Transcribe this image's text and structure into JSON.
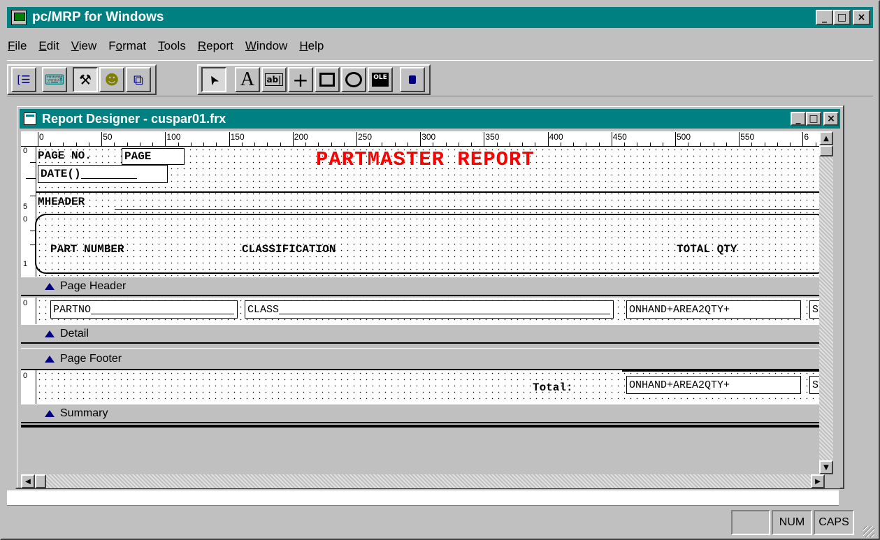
{
  "app": {
    "title": "pc/MRP for Windows",
    "window_buttons": {
      "minimize": "_",
      "maximize": "□",
      "close": "×"
    }
  },
  "menu": [
    {
      "label": "File",
      "accel": "F",
      "rest": "ile"
    },
    {
      "label": "Edit",
      "accel": "E",
      "rest": "dit"
    },
    {
      "label": "View",
      "accel": "V",
      "rest": "iew"
    },
    {
      "label": "Format",
      "accel": "o",
      "pre": "F",
      "rest": "rmat"
    },
    {
      "label": "Tools",
      "accel": "T",
      "rest": "ools"
    },
    {
      "label": "Report",
      "accel": "R",
      "rest": "eport"
    },
    {
      "label": "Window",
      "accel": "W",
      "rest": "indow"
    },
    {
      "label": "Help",
      "accel": "H",
      "rest": "elp"
    }
  ],
  "toolbar": {
    "group1": [
      "field-list-icon",
      "data-environment-icon",
      "tools-icon",
      "color-palette-icon",
      "layout-icon"
    ],
    "group2": [
      "pointer-icon",
      "label-tool-icon",
      "field-tool-icon",
      "line-tool-icon",
      "rectangle-tool-icon",
      "rounded-rect-tool-icon",
      "ole-object-icon"
    ],
    "group3": [
      "lock-icon"
    ],
    "glyphs": {
      "field-list-icon": "[☰",
      "data-environment-icon": "⌨",
      "tools-icon": "⚒",
      "color-palette-icon": "☻",
      "layout-icon": "⧉",
      "pointer-icon": "➤",
      "label-tool-icon": "A",
      "field-tool-icon": "ab|",
      "line-tool-icon": "+",
      "rectangle-tool-icon": "□",
      "rounded-rect-tool-icon": "○",
      "ole-object-icon": "OLE",
      "lock-icon": "🔒"
    }
  },
  "designer": {
    "title": "Report Designer - cuspar01.frx",
    "ruler_labels": [
      "0",
      "50",
      "100",
      "150",
      "200",
      "250",
      "300",
      "350",
      "400",
      "450",
      "500",
      "550",
      "6"
    ],
    "page_header": {
      "page_no_label": "PAGE NO.",
      "page_field": "PAGE",
      "date_field": "DATE()",
      "report_title": "PARTMASTER REPORT",
      "mheader": "MHEADER",
      "col_part_number": "PART NUMBER",
      "col_classification": "CLASSIFICATION",
      "col_total_qty": "TOTAL QTY",
      "vruler": [
        "0",
        "5",
        "0",
        "1"
      ]
    },
    "bands": {
      "page_header": "Page Header",
      "detail": "Detail",
      "page_footer": "Page Footer",
      "summary": "Summary"
    },
    "detail": {
      "partno": "PARTNO",
      "class": "CLASS",
      "qty_expr": "ONHAND+AREA2QTY+",
      "st": "ST",
      "vruler": "0"
    },
    "summary": {
      "total_label": "Total:",
      "qty_expr": "ONHAND+AREA2QTY+",
      "st": "ST",
      "vruler": "0"
    }
  },
  "status": {
    "blank": "",
    "num": "NUM",
    "caps": "CAPS"
  },
  "colors": {
    "title_bar": "#008080",
    "report_title": "#ff0000",
    "band_triangle": "#000080"
  }
}
